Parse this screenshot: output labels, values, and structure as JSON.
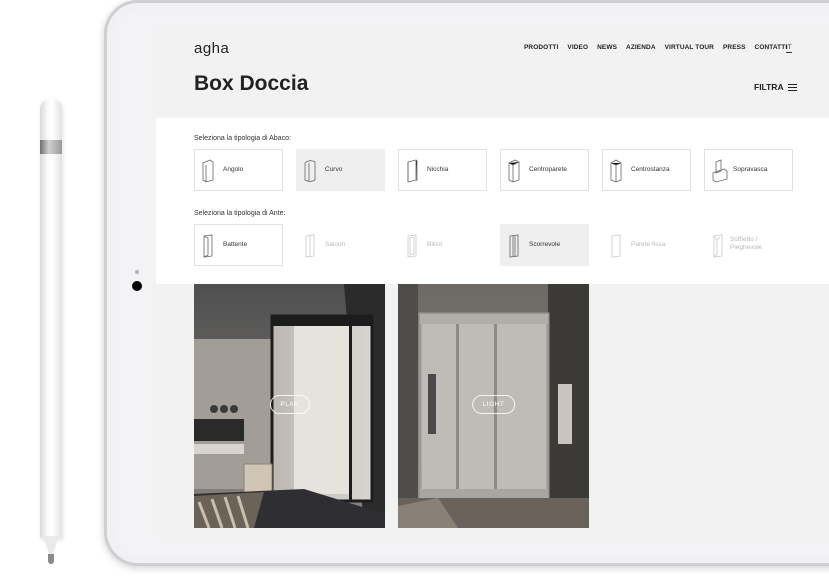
{
  "site": {
    "logo": "agha",
    "nav": [
      "PRODOTTI",
      "VIDEO",
      "NEWS",
      "AZIENDA",
      "VIRTUAL TOUR",
      "PRESS",
      "CONTATTI"
    ],
    "language": "IT"
  },
  "page": {
    "title": "Box Doccia",
    "filter_label": "FILTRA"
  },
  "abaco": {
    "label": "Seleziona la tipologia di Abaco:",
    "options": [
      {
        "label": "Angolo",
        "state": "normal"
      },
      {
        "label": "Curvo",
        "state": "selected"
      },
      {
        "label": "Nicchia",
        "state": "normal"
      },
      {
        "label": "Centroparete",
        "state": "normal"
      },
      {
        "label": "Centrostanza",
        "state": "normal"
      },
      {
        "label": "Sopravasca",
        "state": "normal"
      }
    ]
  },
  "ante": {
    "label": "Seleziona la tipologia di Ante:",
    "options": [
      {
        "label": "Battente",
        "state": "normal"
      },
      {
        "label": "Saloon",
        "state": "disabled"
      },
      {
        "label": "Bilico",
        "state": "disabled"
      },
      {
        "label": "Scorrevole",
        "state": "selected"
      },
      {
        "label": "Parete fissa",
        "state": "disabled"
      },
      {
        "label": "Soffietto / Pieghevole",
        "state": "disabled"
      }
    ]
  },
  "products": [
    {
      "name": "PLAY",
      "image": "dark-framed-shower-photo"
    },
    {
      "name": "LIGHT",
      "image": "sliding-door-shower-photo"
    }
  ],
  "colors": {
    "header_bg": "#f2f2f2",
    "selected_bg": "#efefef",
    "text": "#222222"
  }
}
